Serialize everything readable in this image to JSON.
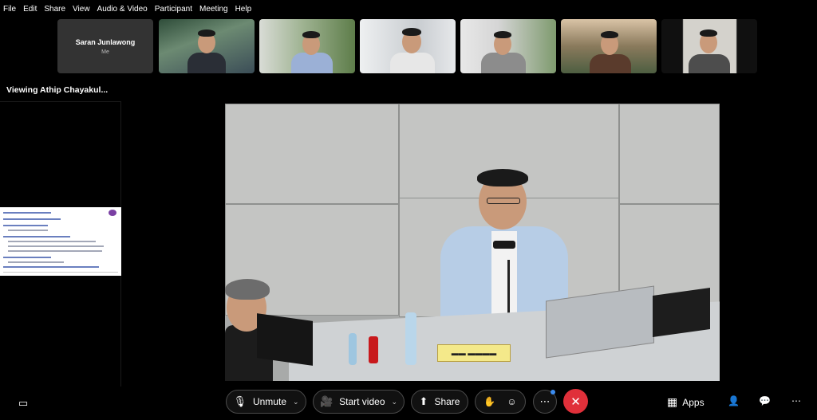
{
  "menu": [
    "File",
    "Edit",
    "Share",
    "View",
    "Audio & Video",
    "Participant",
    "Meeting",
    "Help"
  ],
  "self_tile": {
    "name": "Saran Junlawong",
    "label": "Me"
  },
  "viewing_label": "Viewing Athip Chayakul...",
  "controls": {
    "unmute": "Unmute",
    "start_video": "Start video",
    "share": "Share",
    "apps": "Apps"
  },
  "icons": {
    "mic_muted": "🎙",
    "video_off": "🎥",
    "share": "⬆",
    "raise_hand": "✋",
    "reactions": "☺",
    "more": "⋯",
    "end_call": "✕",
    "apps": "▦",
    "participants": "👤",
    "chat": "💬",
    "captions": "▭",
    "chevron": "⌄"
  },
  "colors": {
    "end_call": "#e0303a",
    "notification_dot": "#3b8cf0"
  }
}
